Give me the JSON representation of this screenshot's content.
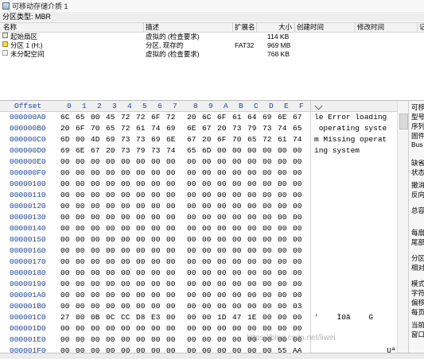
{
  "window": {
    "tab_title": "可移动存储介质 1",
    "partition_type": "分区类型: MBR"
  },
  "grid": {
    "columns": [
      "名称",
      "描述",
      "扩展名",
      "大小",
      "创建时间",
      "修改时间",
      "记"
    ],
    "rows": [
      {
        "icon": "disk-icon",
        "name": "起始扇区",
        "desc": "虚拟的 (检查要求)",
        "ext": "",
        "size": "114 KB"
      },
      {
        "icon": "partition-icon",
        "name": "分区 1 (H:)",
        "desc": "分区, 现存的",
        "ext": "FAT32",
        "size": "969 MB"
      },
      {
        "icon": "unallocated-icon",
        "name": "未分配空间",
        "desc": "虚拟的 (检查要求)",
        "ext": "",
        "size": "768 KB"
      }
    ]
  },
  "hex": {
    "offset_label": "Offset",
    "columns": [
      "0",
      "1",
      "2",
      "3",
      "4",
      "5",
      "6",
      "7",
      "8",
      "9",
      "A",
      "B",
      "C",
      "D",
      "E",
      "F"
    ],
    "rows": [
      {
        "offset": "000000A0",
        "bytes": [
          "6C",
          "65",
          "00",
          "45",
          "72",
          "72",
          "6F",
          "72",
          "20",
          "6C",
          "6F",
          "61",
          "64",
          "69",
          "6E",
          "67"
        ]
      },
      {
        "offset": "000000B0",
        "bytes": [
          "20",
          "6F",
          "70",
          "65",
          "72",
          "61",
          "74",
          "69",
          "6E",
          "67",
          "20",
          "73",
          "79",
          "73",
          "74",
          "65"
        ]
      },
      {
        "offset": "000000C0",
        "bytes": [
          "6D",
          "00",
          "4D",
          "69",
          "73",
          "73",
          "69",
          "6E",
          "67",
          "20",
          "6F",
          "70",
          "65",
          "72",
          "61",
          "74"
        ]
      },
      {
        "offset": "000000D0",
        "bytes": [
          "69",
          "6E",
          "67",
          "20",
          "73",
          "79",
          "73",
          "74",
          "65",
          "6D",
          "00",
          "00",
          "00",
          "00",
          "00",
          "00"
        ]
      },
      {
        "offset": "000000E0",
        "bytes": [
          "00",
          "00",
          "00",
          "00",
          "00",
          "00",
          "00",
          "00",
          "00",
          "00",
          "00",
          "00",
          "00",
          "00",
          "00",
          "00"
        ]
      },
      {
        "offset": "000000F0",
        "bytes": [
          "00",
          "00",
          "00",
          "00",
          "00",
          "00",
          "00",
          "00",
          "00",
          "00",
          "00",
          "00",
          "00",
          "00",
          "00",
          "00"
        ]
      },
      {
        "offset": "00000100",
        "bytes": [
          "00",
          "00",
          "00",
          "00",
          "00",
          "00",
          "00",
          "00",
          "00",
          "00",
          "00",
          "00",
          "00",
          "00",
          "00",
          "00"
        ]
      },
      {
        "offset": "00000110",
        "bytes": [
          "00",
          "00",
          "00",
          "00",
          "00",
          "00",
          "00",
          "00",
          "00",
          "00",
          "00",
          "00",
          "00",
          "00",
          "00",
          "00"
        ]
      },
      {
        "offset": "00000120",
        "bytes": [
          "00",
          "00",
          "00",
          "00",
          "00",
          "00",
          "00",
          "00",
          "00",
          "00",
          "00",
          "00",
          "00",
          "00",
          "00",
          "00"
        ]
      },
      {
        "offset": "00000130",
        "bytes": [
          "00",
          "00",
          "00",
          "00",
          "00",
          "00",
          "00",
          "00",
          "00",
          "00",
          "00",
          "00",
          "00",
          "00",
          "00",
          "00"
        ]
      },
      {
        "offset": "00000140",
        "bytes": [
          "00",
          "00",
          "00",
          "00",
          "00",
          "00",
          "00",
          "00",
          "00",
          "00",
          "00",
          "00",
          "00",
          "00",
          "00",
          "00"
        ]
      },
      {
        "offset": "00000150",
        "bytes": [
          "00",
          "00",
          "00",
          "00",
          "00",
          "00",
          "00",
          "00",
          "00",
          "00",
          "00",
          "00",
          "00",
          "00",
          "00",
          "00"
        ]
      },
      {
        "offset": "00000160",
        "bytes": [
          "00",
          "00",
          "00",
          "00",
          "00",
          "00",
          "00",
          "00",
          "00",
          "00",
          "00",
          "00",
          "00",
          "00",
          "00",
          "00"
        ]
      },
      {
        "offset": "00000170",
        "bytes": [
          "00",
          "00",
          "00",
          "00",
          "00",
          "00",
          "00",
          "00",
          "00",
          "00",
          "00",
          "00",
          "00",
          "00",
          "00",
          "00"
        ]
      },
      {
        "offset": "00000180",
        "bytes": [
          "00",
          "00",
          "00",
          "00",
          "00",
          "00",
          "00",
          "00",
          "00",
          "00",
          "00",
          "00",
          "00",
          "00",
          "00",
          "00"
        ]
      },
      {
        "offset": "00000190",
        "bytes": [
          "00",
          "00",
          "00",
          "00",
          "00",
          "00",
          "00",
          "00",
          "00",
          "00",
          "00",
          "00",
          "00",
          "00",
          "00",
          "00"
        ]
      },
      {
        "offset": "000001A0",
        "bytes": [
          "00",
          "00",
          "00",
          "00",
          "00",
          "00",
          "00",
          "00",
          "00",
          "00",
          "00",
          "00",
          "00",
          "00",
          "00",
          "00"
        ]
      },
      {
        "offset": "000001B0",
        "bytes": [
          "00",
          "00",
          "00",
          "00",
          "00",
          "00",
          "00",
          "00",
          "00",
          "00",
          "00",
          "00",
          "00",
          "00",
          "00",
          "03"
        ]
      },
      {
        "offset": "000001C0",
        "bytes": [
          "27",
          "00",
          "0B",
          "0C",
          "CC",
          "D8",
          "E3",
          "00",
          "00",
          "00",
          "1D",
          "47",
          "1E",
          "00",
          "00",
          "00"
        ]
      },
      {
        "offset": "000001D0",
        "bytes": [
          "00",
          "00",
          "00",
          "00",
          "00",
          "00",
          "00",
          "00",
          "00",
          "00",
          "00",
          "00",
          "00",
          "00",
          "00",
          "00"
        ]
      },
      {
        "offset": "000001E0",
        "bytes": [
          "00",
          "00",
          "00",
          "00",
          "00",
          "00",
          "00",
          "00",
          "00",
          "00",
          "00",
          "00",
          "00",
          "00",
          "00",
          "00"
        ]
      },
      {
        "offset": "000001F0",
        "bytes": [
          "00",
          "00",
          "00",
          "00",
          "00",
          "00",
          "00",
          "00",
          "00",
          "00",
          "00",
          "00",
          "00",
          "00",
          "55",
          "AA"
        ]
      }
    ],
    "ascii": [
      "le Error loading",
      " operating syste",
      "m Missing operat",
      "ing system",
      "",
      "",
      "",
      "",
      "",
      "",
      "",
      "",
      "",
      "",
      "",
      "",
      "",
      "",
      "'    Ì0ã    G",
      "",
      "",
      "                Uª"
    ]
  },
  "info_panel": {
    "labels": [
      "可移",
      "型号",
      "序列",
      "固件",
      "Bus",
      "缺省",
      "状态",
      "撤消",
      "反向",
      "总容",
      "每扇",
      "尾部",
      "分区",
      "相对",
      "模式",
      "字符",
      "偏移",
      "每页",
      "当前",
      "窗口"
    ]
  },
  "watermark": "https://blog.csdn.net/liwei"
}
